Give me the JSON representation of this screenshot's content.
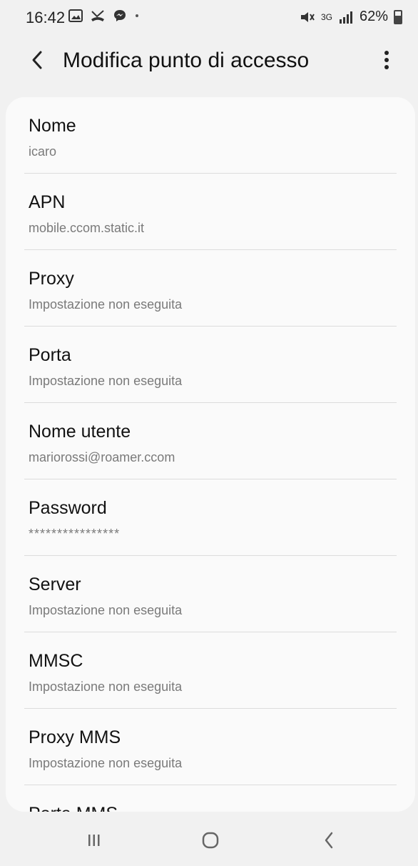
{
  "status_bar": {
    "time": "16:42",
    "network": "3G",
    "battery": "62%",
    "icons": [
      "gallery-icon",
      "missed-call-icon",
      "messenger-icon",
      "dot-icon",
      "mute-icon",
      "signal-icon",
      "battery-icon"
    ]
  },
  "header": {
    "title": "Modifica punto di accesso",
    "back_icon": "chevron-left-icon",
    "more_icon": "more-vertical-icon"
  },
  "apn_fields": [
    {
      "label": "Nome",
      "value": "icaro"
    },
    {
      "label": "APN",
      "value": "mobile.ccom.static.it"
    },
    {
      "label": "Proxy",
      "value": "Impostazione non eseguita"
    },
    {
      "label": "Porta",
      "value": "Impostazione non eseguita"
    },
    {
      "label": "Nome utente",
      "value": "mariorossi@roamer.ccom"
    },
    {
      "label": "Password",
      "value": "****************"
    },
    {
      "label": "Server",
      "value": "Impostazione non eseguita"
    },
    {
      "label": "MMSC",
      "value": "Impostazione non eseguita"
    },
    {
      "label": "Proxy MMS",
      "value": "Impostazione non eseguita"
    },
    {
      "label": "Porta MMS",
      "value": ""
    }
  ],
  "nav_bar": {
    "recent_icon": "recent-apps-icon",
    "home_icon": "home-icon",
    "back_icon": "back-icon"
  },
  "colors": {
    "background": "#f1f1f1",
    "card": "#fafafa",
    "primary_text": "#121212",
    "secondary_text": "#7a7a7a",
    "divider": "#dcdcdc"
  }
}
